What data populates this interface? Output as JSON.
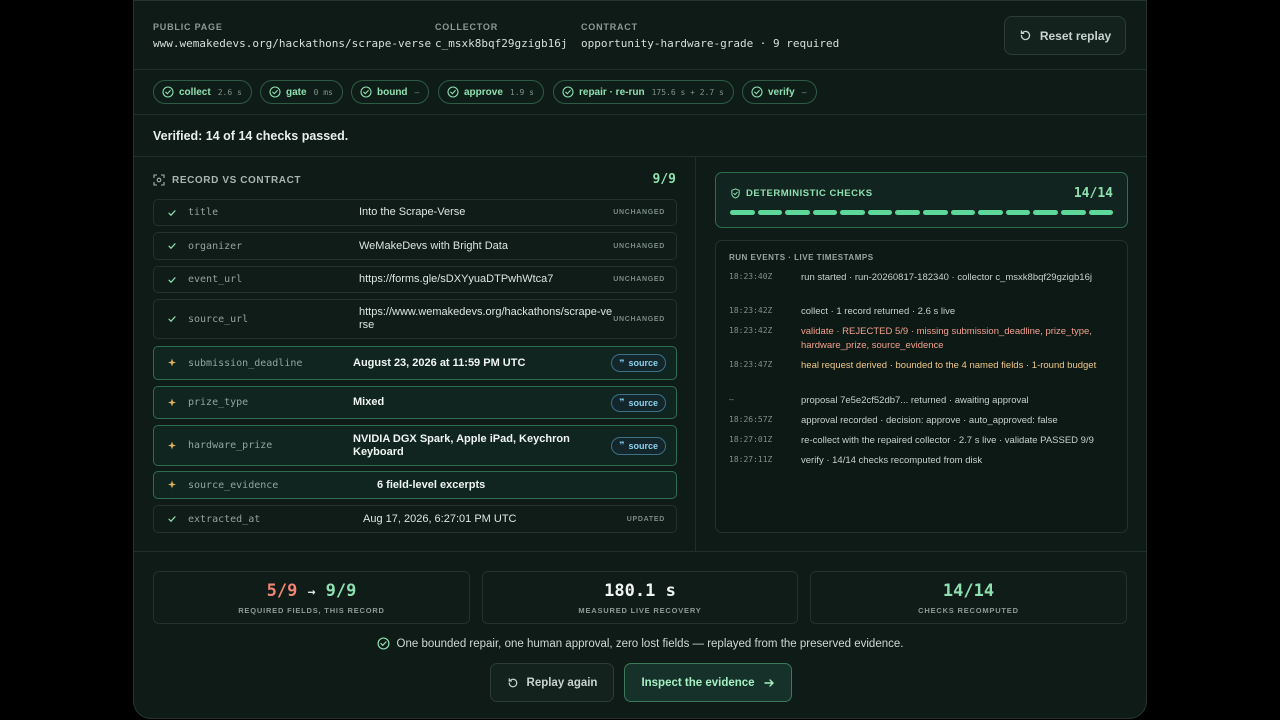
{
  "header": {
    "public_page_label": "PUBLIC PAGE",
    "public_page_value": "www.wemakedevs.org/hackathons/scrape-verse",
    "collector_label": "COLLECTOR",
    "collector_value": "c_msxk8bqf29gzigb16j",
    "contract_label": "CONTRACT",
    "contract_value": "opportunity-hardware-grade · 9 required",
    "reset_label": "Reset replay"
  },
  "stages": [
    {
      "name": "collect",
      "time": "2.6 s"
    },
    {
      "name": "gate",
      "time": "0 ms"
    },
    {
      "name": "bound",
      "time": "—"
    },
    {
      "name": "approve",
      "time": "1.9 s"
    },
    {
      "name": "repair · re-run",
      "time": "175.6 s + 2.7 s"
    },
    {
      "name": "verify",
      "time": "—"
    }
  ],
  "verified_text": "Verified: 14 of 14 checks passed.",
  "record": {
    "title": "RECORD VS CONTRACT",
    "count": "9/9",
    "rows": [
      {
        "field": "title",
        "value": "Into the Scrape-Verse",
        "tag": "UNCHANGED"
      },
      {
        "field": "organizer",
        "value": "WeMakeDevs with Bright Data",
        "tag": "UNCHANGED"
      },
      {
        "field": "event_url",
        "value": "https://forms.gle/sDXYyuaDTPwhWtca7",
        "tag": "UNCHANGED"
      },
      {
        "field": "source_url",
        "value": "https://www.wemakedevs.org/hackathons/scrape-verse",
        "tag": "UNCHANGED"
      },
      {
        "field": "submission_deadline",
        "value": "August 23, 2026 at 11:59 PM UTC",
        "source": "source"
      },
      {
        "field": "prize_type",
        "value": "Mixed",
        "source": "source"
      },
      {
        "field": "hardware_prize",
        "value": "NVIDIA DGX Spark, Apple iPad, Keychron Keyboard",
        "source": "source"
      },
      {
        "field": "source_evidence",
        "value": "6 field-level excerpts"
      },
      {
        "field": "extracted_at",
        "value": "Aug 17, 2026, 6:27:01 PM UTC",
        "tag": "UPDATED"
      }
    ]
  },
  "deterministic": {
    "title": "DETERMINISTIC CHECKS",
    "count": "14/14",
    "passed": 14,
    "total": 14
  },
  "events": {
    "title": "RUN EVENTS · LIVE TIMESTAMPS",
    "items": [
      {
        "ts": "18:23:40Z",
        "text": "run started · run-20260817-182340 · collector c_msxk8bqf29gzigb16j",
        "kind": "normal"
      },
      {
        "ts": "18:23:42Z",
        "text": "collect · 1 record returned · 2.6 s live",
        "kind": "normal"
      },
      {
        "ts": "18:23:42Z",
        "text": "validate · REJECTED 5/9 · missing submission_deadline, prize_type, hardware_prize, source_evidence",
        "kind": "err"
      },
      {
        "ts": "18:23:47Z",
        "text": "heal request derived · bounded to the 4 named fields · 1-round budget",
        "kind": "warn"
      },
      {
        "ts": "—",
        "text": "proposal 7e5e2cf52db7... returned · awaiting approval",
        "kind": "normal"
      },
      {
        "ts": "18:26:57Z",
        "text": "approval recorded · decision: approve · auto_approved: false",
        "kind": "normal"
      },
      {
        "ts": "18:27:01Z",
        "text": "re-collect with the repaired collector · 2.7 s live · validate PASSED 9/9",
        "kind": "normal"
      },
      {
        "ts": "18:27:11Z",
        "text": "verify · 14/14 checks recomputed from disk",
        "kind": "normal"
      }
    ]
  },
  "stats": {
    "fields_before": "5/9",
    "fields_arrow": "→",
    "fields_after": "9/9",
    "fields_label": "REQUIRED FIELDS, THIS RECORD",
    "recovery_value": "180.1 s",
    "recovery_label": "MEASURED LIVE RECOVERY",
    "checks_value": "14/14",
    "checks_label": "CHECKS RECOMPUTED"
  },
  "summary_text": "One bounded repair, one human approval, zero lost fields — replayed from the preserved evidence.",
  "buttons": {
    "replay_label": "Replay again",
    "inspect_label": "Inspect the evidence"
  },
  "colors": {
    "accent_green": "#8fe0b0",
    "error_red": "#f2a08e",
    "warn_amber": "#f0c98a",
    "source_blue": "#8fd2ee"
  }
}
